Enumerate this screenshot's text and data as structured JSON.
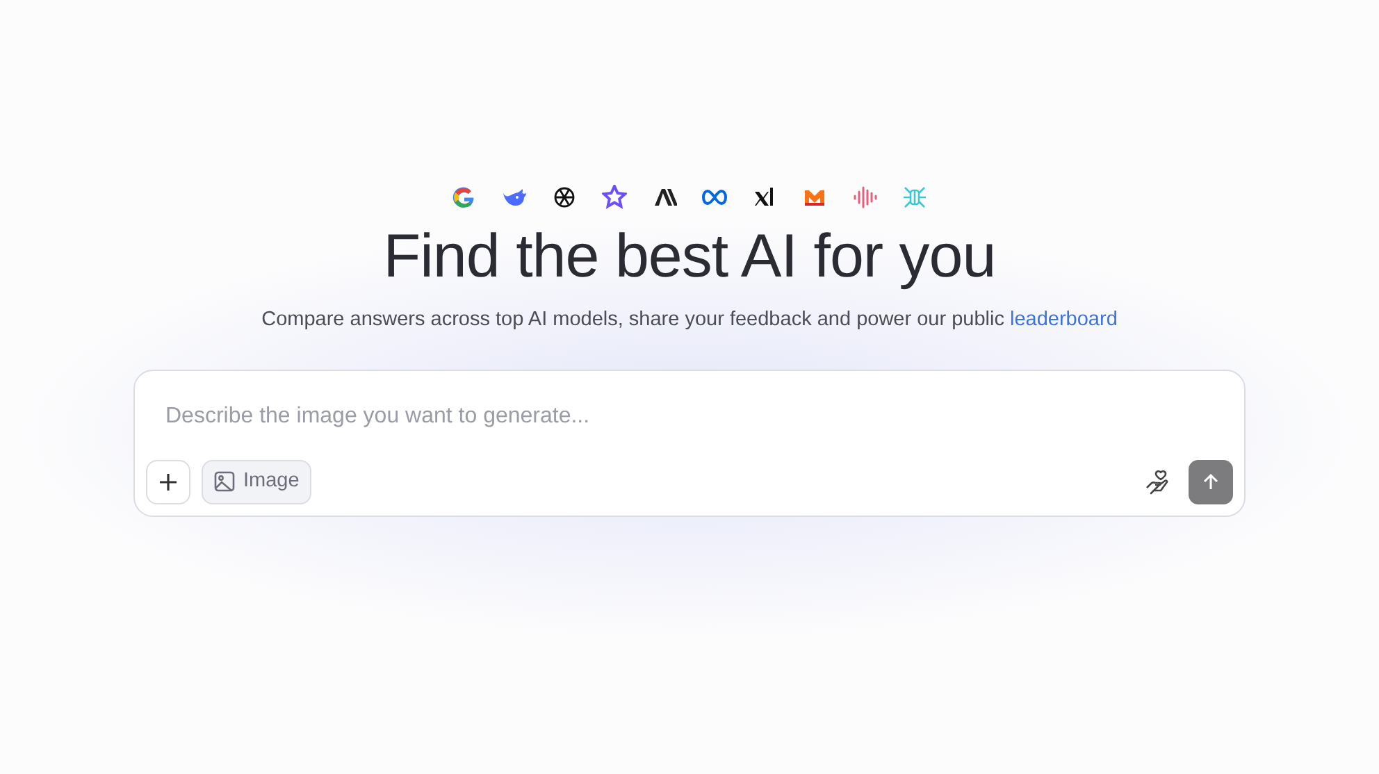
{
  "hero": {
    "title": "Find the best AI for you",
    "subtitle": "Compare answers across top AI models, share your feedback and power our public ",
    "subtitle_link": "leaderboard"
  },
  "prompt": {
    "placeholder": "Describe the image you want to generate...",
    "image_button": "Image",
    "send_disabled": true
  }
}
